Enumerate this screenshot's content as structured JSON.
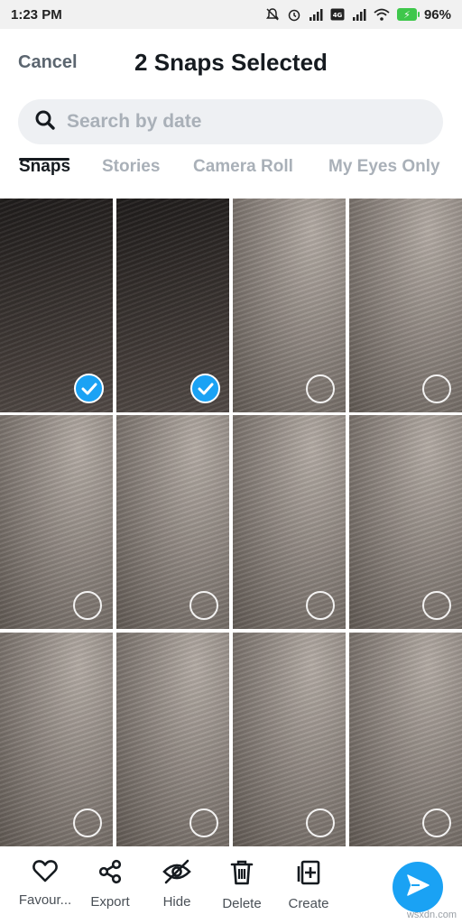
{
  "status_bar": {
    "time": "1:23 PM",
    "battery": "96%",
    "icons": [
      "mute-bell-icon",
      "alarm-icon",
      "signal-icon",
      "volte-icon",
      "signal-icon",
      "wifi-icon",
      "battery-charging-icon"
    ]
  },
  "header": {
    "cancel_label": "Cancel",
    "title": "2 Snaps Selected"
  },
  "search": {
    "placeholder": "Search by date",
    "value": ""
  },
  "tabs": [
    {
      "label": "Snaps",
      "active": true
    },
    {
      "label": "Stories",
      "active": false
    },
    {
      "label": "Camera Roll",
      "active": false
    },
    {
      "label": "My Eyes Only",
      "active": false
    }
  ],
  "grid": {
    "cells": [
      {
        "tone": "dark",
        "selected": true
      },
      {
        "tone": "dark",
        "selected": true
      },
      {
        "tone": "light",
        "selected": false
      },
      {
        "tone": "light",
        "selected": false
      },
      {
        "tone": "light",
        "selected": false
      },
      {
        "tone": "light",
        "selected": false
      },
      {
        "tone": "light",
        "selected": false
      },
      {
        "tone": "light",
        "selected": false
      },
      {
        "tone": "light",
        "selected": false
      },
      {
        "tone": "light",
        "selected": false
      },
      {
        "tone": "light",
        "selected": false
      },
      {
        "tone": "light",
        "selected": false
      }
    ]
  },
  "bottom_bar": {
    "actions": [
      {
        "label": "Favour...",
        "icon": "heart-icon"
      },
      {
        "label": "Export",
        "icon": "share-icon"
      },
      {
        "label": "Hide",
        "icon": "eye-off-icon"
      },
      {
        "label": "Delete",
        "icon": "trash-icon"
      },
      {
        "label": "Create",
        "icon": "add-story-icon"
      }
    ],
    "send_icon": "send-arrow-icon"
  },
  "watermark": "wsxdn.com",
  "colors": {
    "accent": "#1aa2f4",
    "title": "#161b20",
    "muted": "#a9b0b8"
  }
}
